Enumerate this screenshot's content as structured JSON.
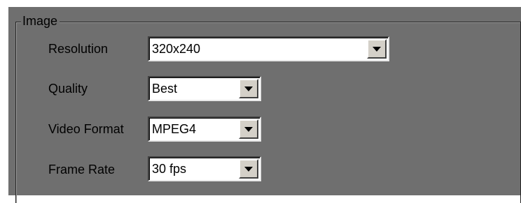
{
  "group": {
    "title": "Image"
  },
  "fields": [
    {
      "label": "Resolution",
      "value": "320x240",
      "icon": "chevron-down-icon"
    },
    {
      "label": "Quality",
      "value": "Best",
      "icon": "chevron-down-icon"
    },
    {
      "label": "Video Format",
      "value": "MPEG4",
      "icon": "chevron-down-icon"
    },
    {
      "label": "Frame Rate",
      "value": "30 fps",
      "icon": "chevron-down-icon"
    }
  ]
}
